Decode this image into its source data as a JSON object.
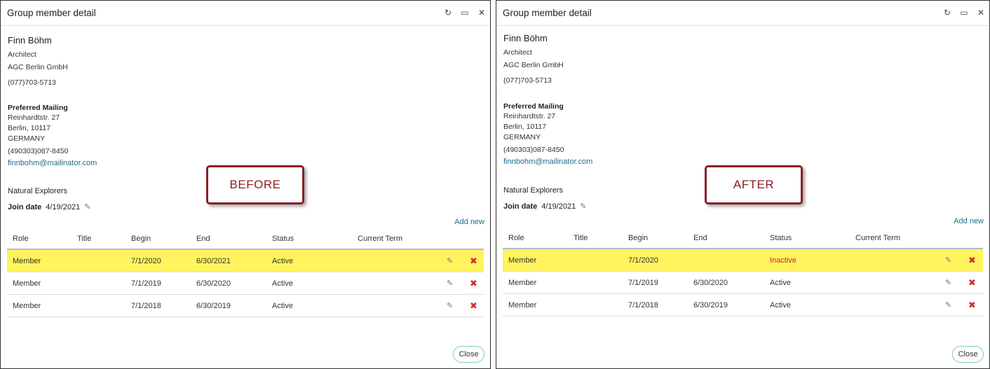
{
  "before": {
    "window_title": "Group member detail",
    "member": {
      "name": "Finn Böhm",
      "job_title": "Architect",
      "company": "AGC Berlin GmbH",
      "phone": "(077)703-5713",
      "mailing_label": "Preferred Mailing",
      "street": "Reinhardtstr. 27",
      "city": "Berlin, 10117",
      "country": "GERMANY",
      "phone2": "(490303)087-8450",
      "email": "finnbohm@mailinator.com"
    },
    "group": {
      "name": "Natural Explorers",
      "join_label": "Join date",
      "join_date": "4/19/2021"
    },
    "add_new": "Add new",
    "columns": [
      "Role",
      "Title",
      "Begin",
      "End",
      "Status",
      "Current Term"
    ],
    "rows": [
      {
        "role": "Member",
        "title": "",
        "begin": "7/1/2020",
        "end": "6/30/2021",
        "status": "Active",
        "current_term": "",
        "highlighted": true
      },
      {
        "role": "Member",
        "title": "",
        "begin": "7/1/2019",
        "end": "6/30/2020",
        "status": "Active",
        "current_term": "",
        "highlighted": false
      },
      {
        "role": "Member",
        "title": "",
        "begin": "7/1/2018",
        "end": "6/30/2019",
        "status": "Active",
        "current_term": "",
        "highlighted": false
      }
    ],
    "close_label": "Close",
    "callout": "BEFORE"
  },
  "after": {
    "window_title": "Group member detail",
    "member": {
      "name": "Finn Böhm",
      "job_title": "Architect",
      "company": "AGC Berlin GmbH",
      "phone": "(077)703-5713",
      "mailing_label": "Preferred Mailing",
      "street": "Reinhardtstr. 27",
      "city": "Berlin, 10117",
      "country": "GERMANY",
      "phone2": "(490303)087-8450",
      "email": "finnbohm@mailinator.com"
    },
    "group": {
      "name": "Natural Explorers",
      "join_label": "Join date",
      "join_date": "4/19/2021"
    },
    "add_new": "Add new",
    "columns": [
      "Role",
      "Title",
      "Begin",
      "End",
      "Status",
      "Current Term"
    ],
    "rows": [
      {
        "role": "Member",
        "title": "",
        "begin": "7/1/2020",
        "end": "",
        "status": "Inactive",
        "current_term": "",
        "highlighted": true
      },
      {
        "role": "Member",
        "title": "",
        "begin": "7/1/2019",
        "end": "6/30/2020",
        "status": "Active",
        "current_term": "",
        "highlighted": false
      },
      {
        "role": "Member",
        "title": "",
        "begin": "7/1/2018",
        "end": "6/30/2019",
        "status": "Active",
        "current_term": "",
        "highlighted": false
      }
    ],
    "close_label": "Close",
    "callout": "AFTER"
  },
  "icons": {
    "refresh": "refresh-icon",
    "maximize": "maximize-icon",
    "close": "close-icon",
    "edit": "pencil-icon",
    "delete": "delete-x-icon"
  },
  "colors": {
    "highlight": "#fff45e",
    "link": "#1f6d87",
    "inactive": "#c62828",
    "delete": "#d32f2f",
    "callout": "#8b1e24"
  }
}
